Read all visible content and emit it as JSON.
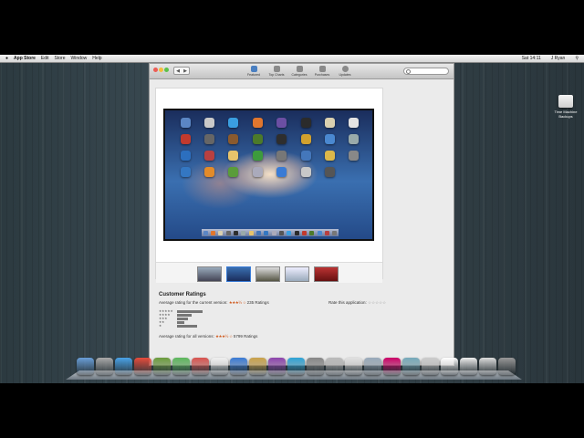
{
  "menubar": {
    "apple": "",
    "app": "App Store",
    "items": [
      "Edit",
      "Store",
      "Window",
      "Help"
    ],
    "clock": "Sat 14:11",
    "user": "J Ryan"
  },
  "window": {
    "toolbar": [
      "Featured",
      "Top Charts",
      "Categories",
      "Purchases",
      "Updates"
    ]
  },
  "ratings": {
    "title": "Customer Ratings",
    "current_label": "Average rating for the current version:",
    "current_count": "235 Ratings",
    "rate_label": "Rate this application:",
    "all_label": "Average rating for all versions:",
    "all_count": "5799 Ratings",
    "stars_filled": "★★★½",
    "stars_empty": "☆",
    "rate_stars": "☆☆☆☆☆"
  },
  "histogram": [
    {
      "stars": "★★★★★",
      "fraction": 0.7
    },
    {
      "stars": "★★★★",
      "fraction": 0.4
    },
    {
      "stars": "★★★",
      "fraction": 0.3
    },
    {
      "stars": "★★",
      "fraction": 0.2
    },
    {
      "stars": "★",
      "fraction": 0.55
    }
  ],
  "desktop_icon": {
    "label": "Time Machine Backups"
  },
  "colors": {
    "accent": "#3b7dd8",
    "star": "#d05a1e"
  }
}
